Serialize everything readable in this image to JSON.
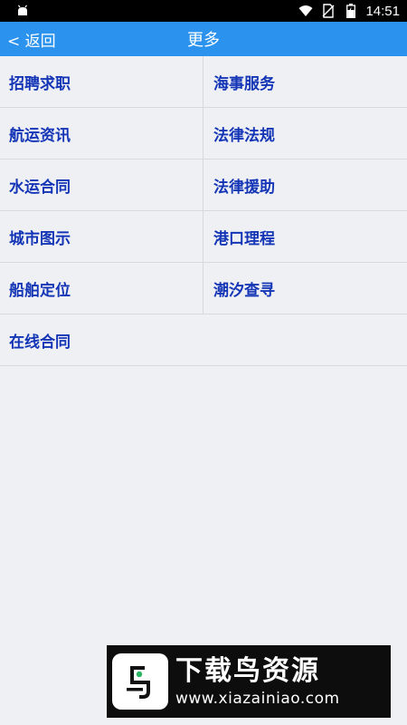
{
  "status_bar": {
    "time": "14:51",
    "icons": [
      "android-debug-icon",
      "wifi-icon",
      "no-sim-icon",
      "battery-charging-icon"
    ]
  },
  "nav": {
    "back_label": "< 返回",
    "title": "更多"
  },
  "menu": {
    "rows": [
      [
        "招聘求职",
        "海事服务"
      ],
      [
        "航运资讯",
        "法律法规"
      ],
      [
        "水运合同",
        "法律援助"
      ],
      [
        "城市图示",
        "港口理程"
      ],
      [
        "船舶定位",
        "潮汐查寻"
      ],
      [
        "在线合同",
        ""
      ]
    ]
  },
  "watermark": {
    "title": "下载鸟资源",
    "url": "www.xiazainiao.com"
  },
  "colors": {
    "nav_bg": "#2b93ee",
    "item_text": "#1435b6",
    "page_bg": "#eef0f4"
  }
}
